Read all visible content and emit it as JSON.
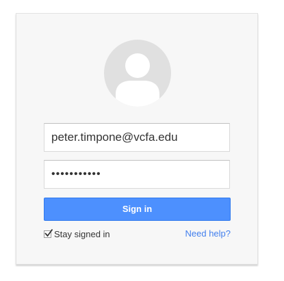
{
  "login": {
    "email_value": "peter.timpone@vcfa.edu",
    "password_masked": "•••••••••••",
    "signin_label": "Sign in",
    "stay_signed_in_label": "Stay signed in",
    "stay_signed_in_checked": true,
    "help_link": "Need help?"
  },
  "colors": {
    "accent": "#4d90fe",
    "link": "#427fed",
    "card_bg": "#f7f7f7",
    "avatar_bg": "#e0e0e0"
  },
  "icons": {
    "avatar": "user-silhouette-icon",
    "checkbox": "checkmark-icon"
  }
}
